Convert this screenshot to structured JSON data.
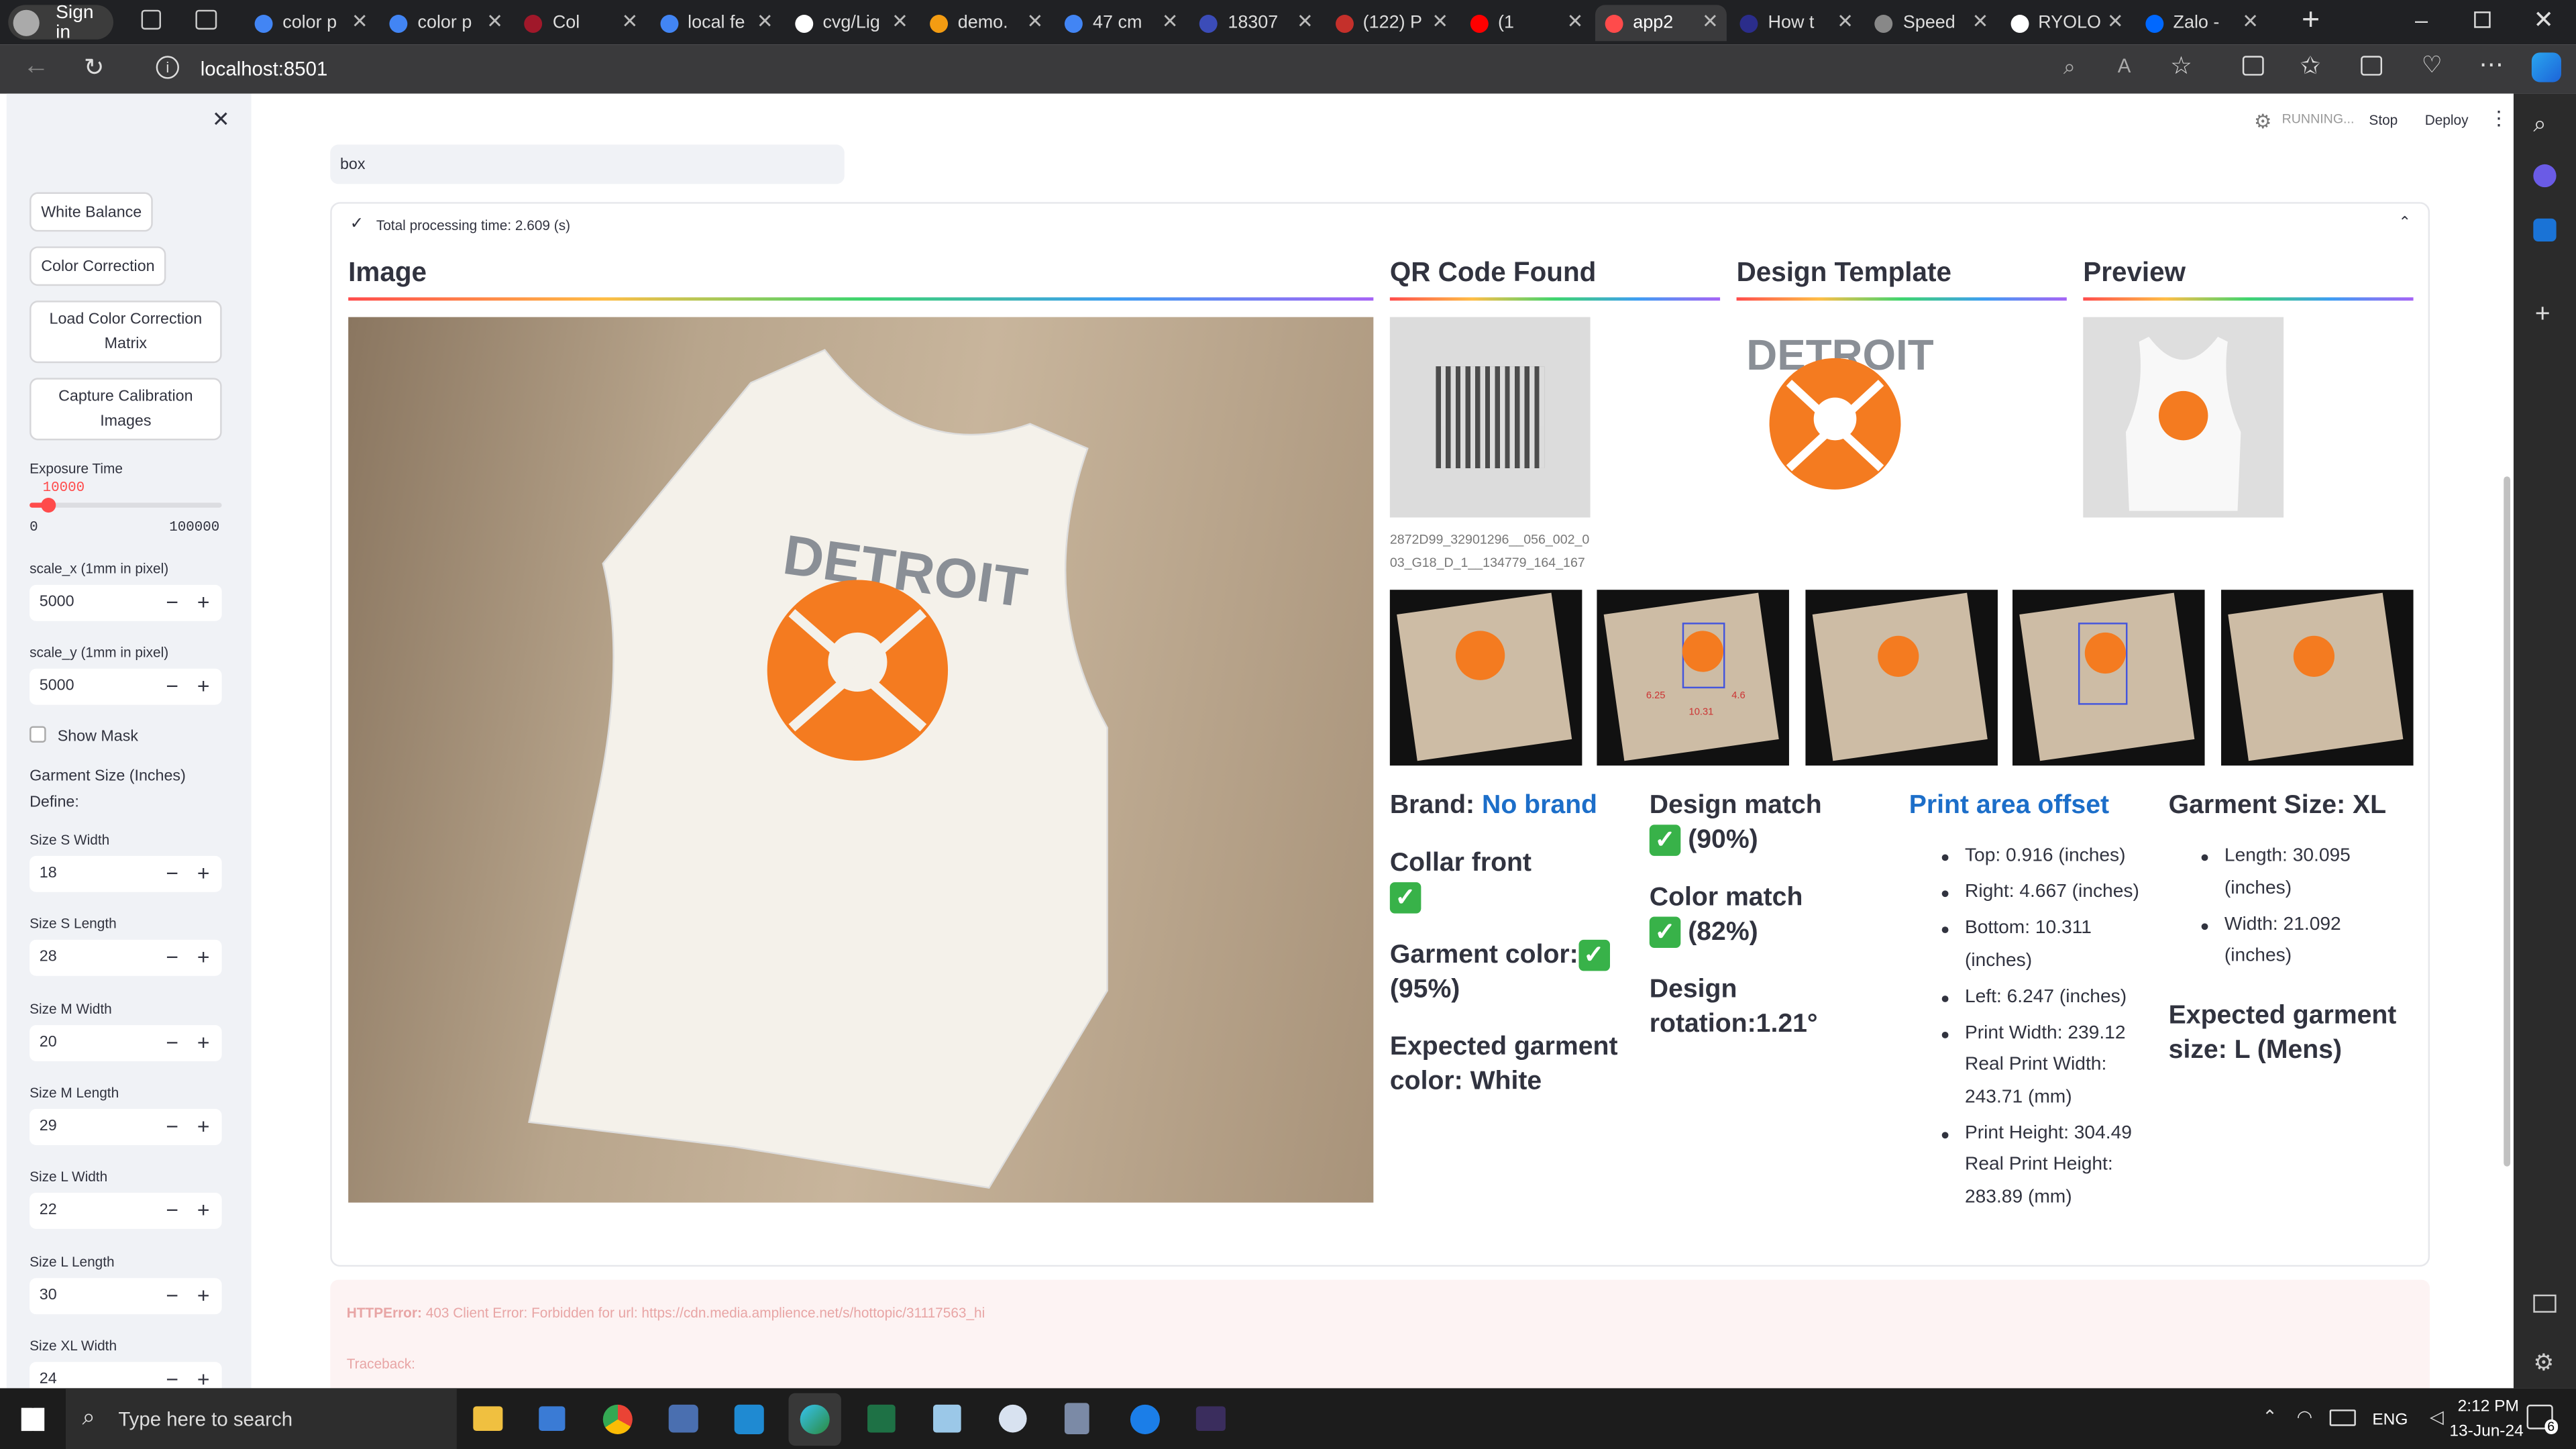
{
  "browser": {
    "profile_label": "Sign in",
    "tabs": [
      {
        "title": "color p",
        "color": "#4285f4"
      },
      {
        "title": "color p",
        "color": "#4285f4"
      },
      {
        "title": "Col",
        "color": "#a0182a"
      },
      {
        "title": "local fe",
        "color": "#4285f4"
      },
      {
        "title": "cvg/Lig",
        "color": "#ffffff"
      },
      {
        "title": "demo.",
        "color": "#f39c12"
      },
      {
        "title": "47 cm",
        "color": "#4285f4"
      },
      {
        "title": "18307",
        "color": "#3b4cb8"
      },
      {
        "title": "(122) P",
        "color": "#c4302b"
      },
      {
        "title": "(1",
        "color": "#ff0000"
      },
      {
        "title": "app2",
        "color": "#ff4b4b"
      },
      {
        "title": "How t",
        "color": "#2b2d8b"
      },
      {
        "title": "Speed",
        "color": "#888888"
      },
      {
        "title": "RYOLO",
        "color": "#ffffff"
      },
      {
        "title": "Zalo -",
        "color": "#0068ff"
      }
    ],
    "url": "localhost:8501"
  },
  "toolbar": {
    "status": "RUNNING...",
    "stop": "Stop",
    "deploy": "Deploy"
  },
  "sidebar": {
    "white_balance": "White Balance",
    "color_correction": "Color Correction",
    "load_matrix": "Load Color Correction Matrix",
    "capture_calibration": "Capture Calibration Images",
    "exposure_label": "Exposure Time",
    "exposure_value": "10000",
    "exposure_fraction": 0.1,
    "exposure_min": "0",
    "exposure_max": "100000",
    "scale_x_label": "scale_x (1mm in pixel)",
    "scale_x": "5000",
    "scale_y_label": "scale_y (1mm in pixel)",
    "scale_y": "5000",
    "show_mask": "Show Mask",
    "garment_size_heading": "Garment Size (Inches)",
    "define": "Define:",
    "fields": [
      {
        "label": "Size S Width",
        "value": "18"
      },
      {
        "label": "Size S Length",
        "value": "28"
      },
      {
        "label": "Size M Width",
        "value": "20"
      },
      {
        "label": "Size M Length",
        "value": "29"
      },
      {
        "label": "Size L Width",
        "value": "22"
      },
      {
        "label": "Size L Length",
        "value": "30"
      },
      {
        "label": "Size XL Width",
        "value": "24"
      }
    ]
  },
  "main": {
    "text_input": "box",
    "processing_time": "Total processing time: 2.609 (s)",
    "headings": {
      "image": "Image",
      "qr": "QR Code Found",
      "design": "Design Template",
      "preview": "Preview"
    },
    "qr_code_text": "2872D99_32901296__056_002_003_G18_D_1__134779_164_167",
    "brand_label": "Brand:",
    "brand_value": "No brand",
    "collar_front": "Collar front",
    "garment_color_label": "Garment color:",
    "garment_color_pct": "(95%)",
    "expected_color": "Expected garment color: White",
    "design_match": "Design match",
    "design_match_pct": "(90%)",
    "color_match": "Color match",
    "color_match_pct": "(82%)",
    "design_rotation": "Design rotation:1.21°",
    "print_area_offset": "Print area offset",
    "offsets": [
      "Top: 0.916 (inches)",
      "Right: 4.667 (inches)",
      "Bottom: 10.311 (inches)",
      "Left: 6.247 (inches)",
      "Print Width: 239.12 Real Print Width: 243.71 (mm)",
      "Print Height: 304.49 Real Print Height: 283.89 (mm)"
    ],
    "garment_size": "Garment Size: XL",
    "sizes": [
      "Length: 30.095 (inches)",
      "Width: 21.092 (inches)"
    ],
    "expected_size": "Expected garment size: L (Mens)",
    "design_text": "DETROIT",
    "error_title": "HTTPError:",
    "error_msg": "403 Client Error: Forbidden for url: https://cdn.media.amplience.net/s/hottopic/31117563_hi",
    "traceback": "Traceback:",
    "thumb_labels": [
      "6.25",
      "10.31",
      "4.6"
    ]
  },
  "taskbar": {
    "search": "Type here to search",
    "time": "2:12 PM",
    "date": "13-Jun-24",
    "lang": "ENG",
    "notif": "6"
  }
}
